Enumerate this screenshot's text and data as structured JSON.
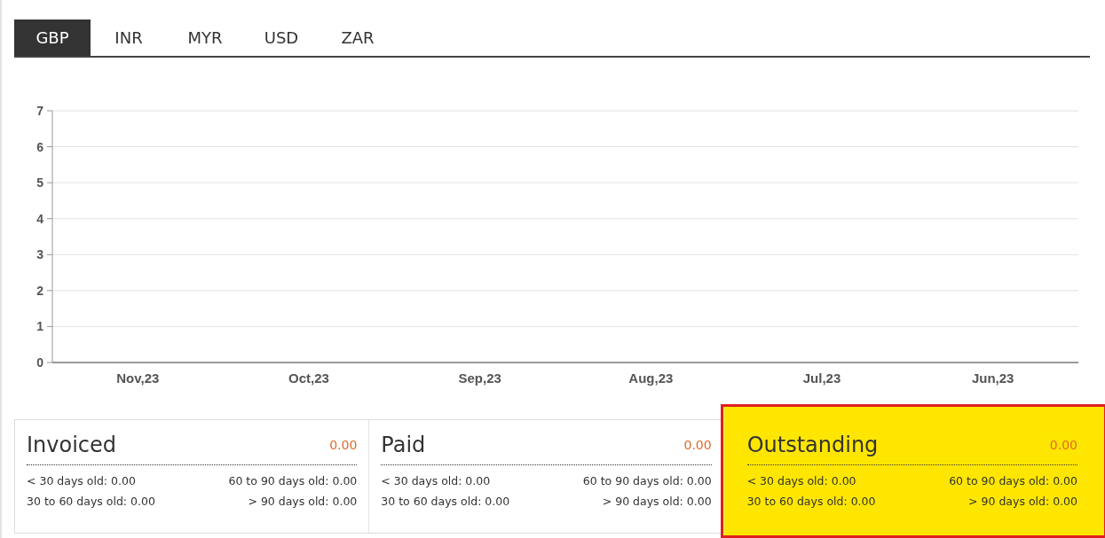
{
  "tabs": [
    {
      "label": "GBP",
      "selected": true
    },
    {
      "label": "INR",
      "selected": false
    },
    {
      "label": "MYR",
      "selected": false
    },
    {
      "label": "USD",
      "selected": false
    },
    {
      "label": "ZAR",
      "selected": false
    }
  ],
  "chart_data": {
    "type": "line",
    "categories": [
      "Nov,23",
      "Oct,23",
      "Sep,23",
      "Aug,23",
      "Jul,23",
      "Jun,23"
    ],
    "ylim": [
      0,
      7
    ],
    "grid": true,
    "yticks": [
      0,
      1,
      2,
      3,
      4,
      5,
      6,
      7
    ]
  },
  "cards": [
    {
      "title": "Invoiced",
      "total": "0.00",
      "highlighted": false,
      "aging": [
        "< 30 days old: 0.00",
        "60 to 90 days old: 0.00",
        "30 to 60 days old: 0.00",
        "> 90 days old: 0.00"
      ]
    },
    {
      "title": "Paid",
      "total": "0.00",
      "highlighted": false,
      "aging": [
        "< 30 days old: 0.00",
        "60 to 90 days old: 0.00",
        "30 to 60 days old: 0.00",
        "> 90 days old: 0.00"
      ]
    },
    {
      "title": "Outstanding",
      "total": "0.00",
      "highlighted": true,
      "aging": [
        "< 30 days old: 0.00",
        "60 to 90 days old: 0.00",
        "30 to 60 days old: 0.00",
        "> 90 days old: 0.00"
      ]
    }
  ]
}
